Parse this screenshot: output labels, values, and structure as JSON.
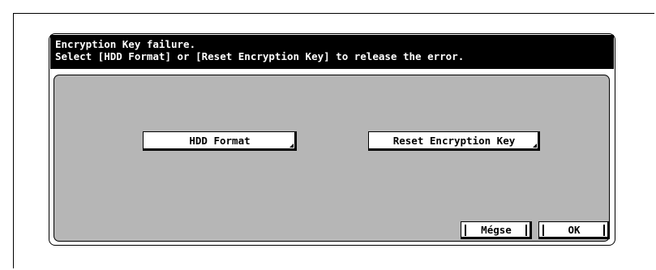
{
  "dialog": {
    "message_line1": "Encryption Key failure.",
    "message_line2": "Select [HDD Format] or [Reset Encryption Key] to release the error."
  },
  "actions": {
    "hdd_format": "HDD Format",
    "reset_key": "Reset Encryption Key"
  },
  "footer": {
    "cancel": "Mégse",
    "ok": "OK"
  }
}
